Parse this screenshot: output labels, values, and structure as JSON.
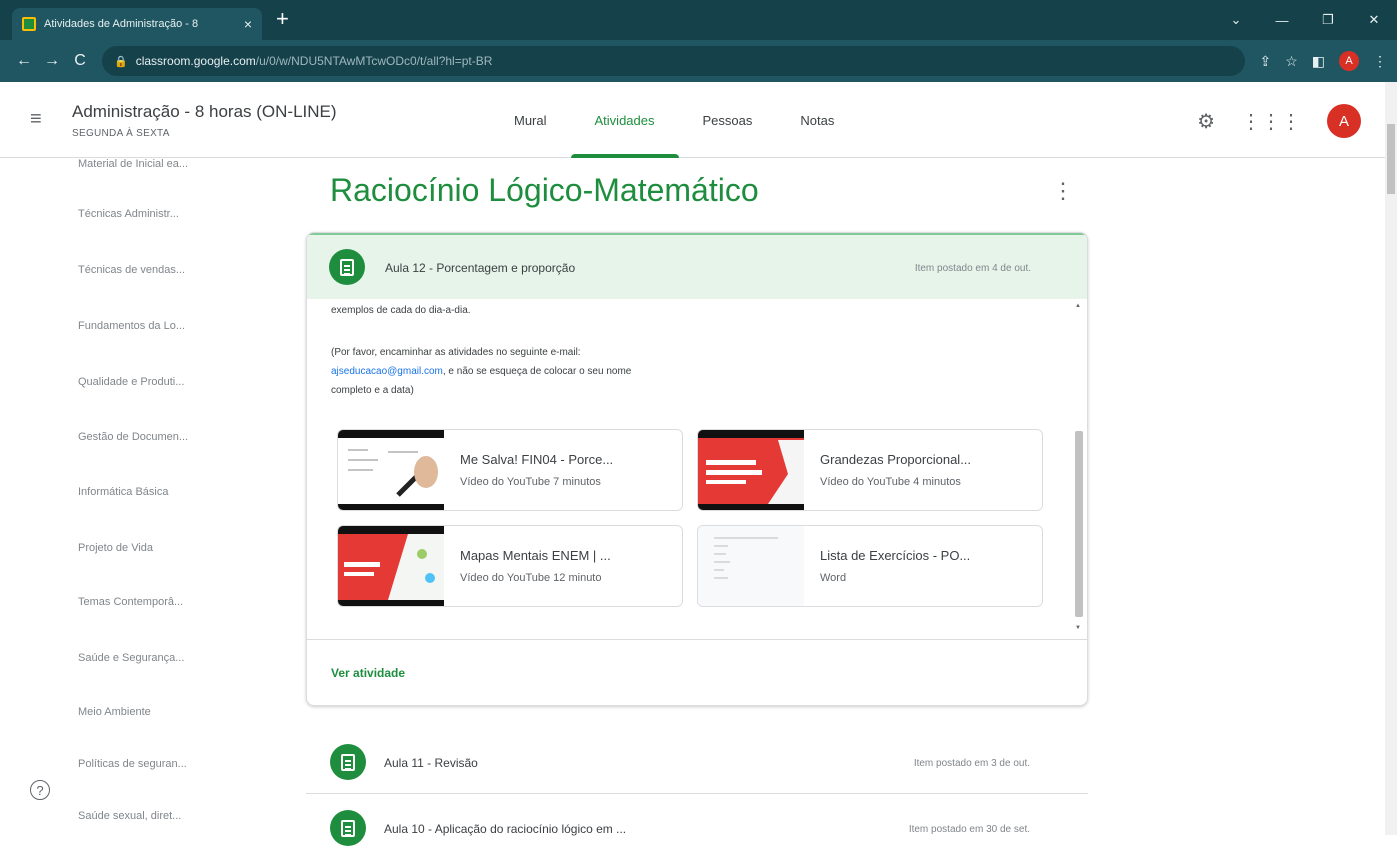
{
  "browser": {
    "tab_title": "Atividades de Administração - 8",
    "tab_close": "×",
    "new_tab": "+",
    "url_host": "classroom.google.com",
    "url_path": "/u/0/w/NDU5NTAwMTcwODc0/t/all?hl=pt-BR",
    "minimize": "—",
    "maximize": "❐",
    "close": "✕",
    "chevron": "⌄"
  },
  "header": {
    "course_title": "Administração - 8 horas (ON-LINE)",
    "course_subtitle": "SEGUNDA À SEXTA",
    "tabs": [
      {
        "label": "Mural"
      },
      {
        "label": "Atividades"
      },
      {
        "label": "Pessoas"
      },
      {
        "label": "Notas"
      }
    ],
    "avatar_letter": "A"
  },
  "topics": [
    "Material de Inicial ea...",
    "Técnicas Administr...",
    "Técnicas de vendas...",
    "Fundamentos da Lo...",
    "Qualidade e Produti...",
    "Gestão de Documen...",
    "Informática Básica",
    "Projeto de Vida",
    "Temas Contemporâ...",
    "Saúde e Segurança...",
    "Meio Ambiente",
    "Políticas de seguran...",
    "Saúde sexual, diret..."
  ],
  "help": "?",
  "section": {
    "title": "Raciocínio Lógico-Matemático",
    "menu": "⋮"
  },
  "expanded": {
    "title": "Aula 12 - Porcentagem e proporção",
    "date": "Item postado em 4 de out.",
    "desc_line1": "exemplos de cada do dia-a-dia.",
    "desc_line2": "(Por favor, encaminhar as atividades no seguinte e-mail:",
    "email": "ajseducacao@gmail.com",
    "desc_line3": ", e não se esqueça de colocar o seu nome",
    "desc_line4": "completo e a data)",
    "attachments": [
      {
        "name": "Me Salva! FIN04 - Porce...",
        "meta": "Vídeo do YouTube   7 minutos"
      },
      {
        "name": "Grandezas Proporcional...",
        "meta": "Vídeo do YouTube   4 minutos"
      },
      {
        "name": "Mapas Mentais ENEM | ...",
        "meta": "Vídeo do YouTube   12 minuto"
      },
      {
        "name": "Lista de Exercícios - PO...",
        "meta": "Word"
      }
    ],
    "link": "Ver atividade"
  },
  "items": [
    {
      "title": "Aula 11 - Revisão",
      "date": "Item postado em 3 de out."
    },
    {
      "title": "Aula 10 - Aplicação do raciocínio lógico em ...",
      "date": "Item postado em 30 de set."
    }
  ],
  "colors": {
    "accent": "#1e8e3e",
    "chrome": "#15414a",
    "avatar": "#d93025"
  }
}
